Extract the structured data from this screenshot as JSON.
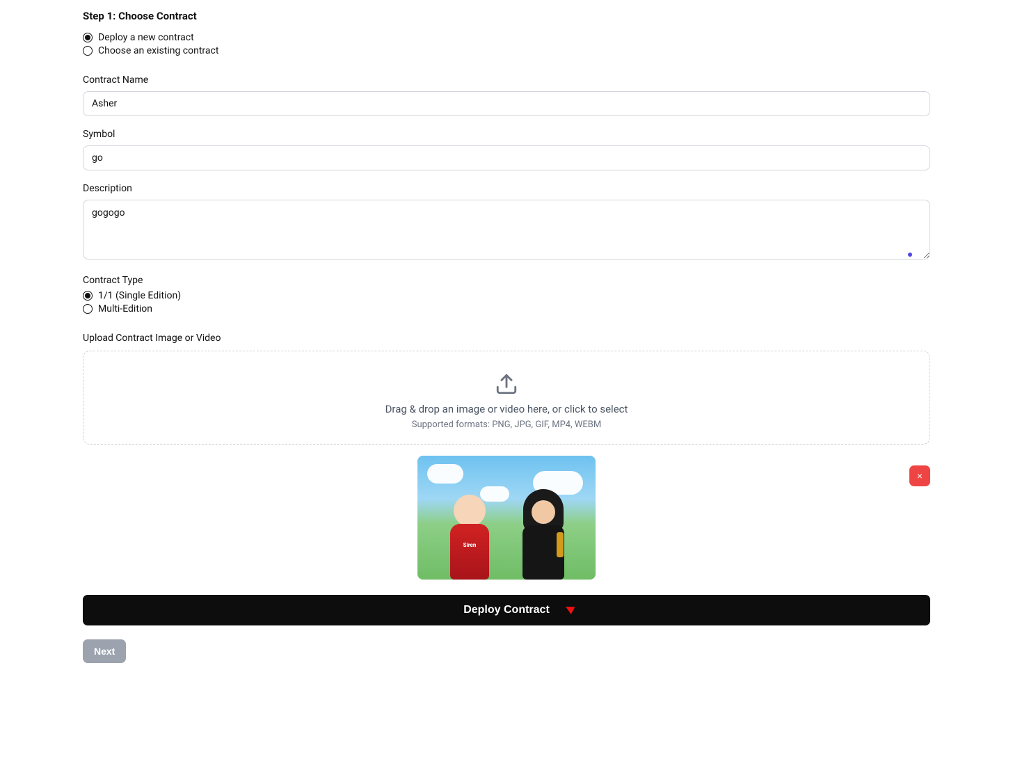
{
  "step_title": "Step 1: Choose Contract",
  "contract_choice": {
    "options": [
      {
        "label": "Deploy a new contract",
        "selected": true
      },
      {
        "label": "Choose an existing contract",
        "selected": false
      }
    ]
  },
  "fields": {
    "contract_name": {
      "label": "Contract Name",
      "value": "Asher"
    },
    "symbol": {
      "label": "Symbol",
      "value": "go"
    },
    "description": {
      "label": "Description",
      "value": "gogogo"
    }
  },
  "contract_type": {
    "label": "Contract Type",
    "options": [
      {
        "label": "1/1 (Single Edition)",
        "selected": true
      },
      {
        "label": "Multi-Edition",
        "selected": false
      }
    ]
  },
  "upload": {
    "label": "Upload Contract Image or Video",
    "dropzone_text": "Drag & drop an image or video here, or click to select",
    "supported_text": "Supported formats: PNG, JPG, GIF, MP4, WEBM",
    "preview_badge": "Siren"
  },
  "buttons": {
    "deploy": "Deploy Contract",
    "next": "Next",
    "remove": "×"
  }
}
